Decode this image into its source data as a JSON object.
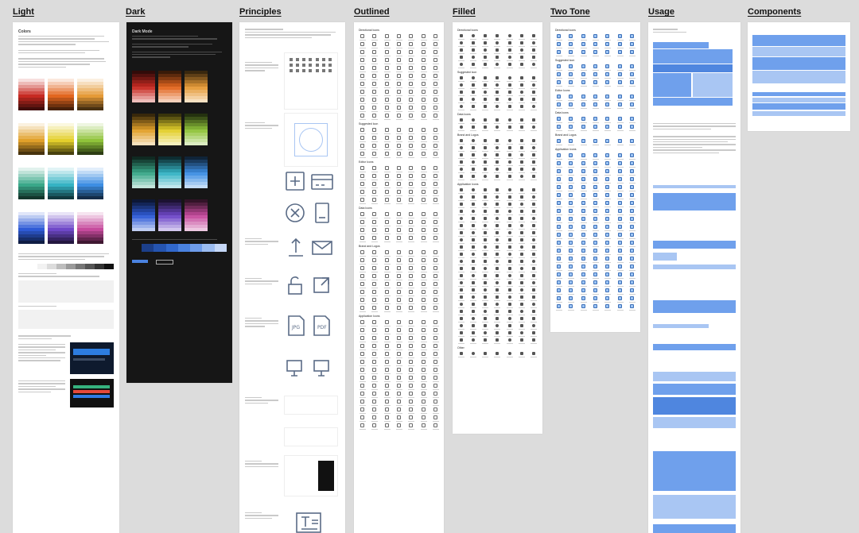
{
  "columns": [
    {
      "id": "light",
      "title": "Light"
    },
    {
      "id": "dark",
      "title": "Dark"
    },
    {
      "id": "principles",
      "title": "Principles"
    },
    {
      "id": "outlined",
      "title": "Outlined"
    },
    {
      "id": "filled",
      "title": "Filled"
    },
    {
      "id": "two_tone",
      "title": "Two Tone"
    },
    {
      "id": "usage",
      "title": "Usage"
    },
    {
      "id": "components",
      "title": "Components"
    }
  ],
  "light": {
    "heading": "Colors",
    "palette_rows": [
      {
        "colors": [
          "#c72a22",
          "#e2661f",
          "#e59a37"
        ]
      },
      {
        "colors": [
          "#e1a02a",
          "#e3cf2b",
          "#8fc33a"
        ]
      },
      {
        "colors": [
          "#3aa889",
          "#35b3c4",
          "#3d8ee3"
        ]
      },
      {
        "colors": [
          "#2f5bd6",
          "#6f48c8",
          "#c64b9d"
        ]
      }
    ],
    "gray_strip": [
      "#ffffff",
      "#f2f2f2",
      "#dcdcdc",
      "#bdbdbd",
      "#9a9a9a",
      "#767676",
      "#555555",
      "#333333",
      "#111111"
    ]
  },
  "dark": {
    "heading": "Dark Mode",
    "palette_rows": [
      {
        "colors": [
          "#c72a22",
          "#e2661f",
          "#e59a37"
        ]
      },
      {
        "colors": [
          "#e1a02a",
          "#e3cf2b",
          "#8fc33a"
        ]
      },
      {
        "colors": [
          "#3aa889",
          "#35b3c4",
          "#3d8ee3"
        ]
      },
      {
        "colors": [
          "#2f5bd6",
          "#6f48c8",
          "#c64b9d"
        ]
      }
    ]
  },
  "outlined": {
    "sections": [
      "Directional Icons",
      "Suggested Icon",
      "Editor Icons",
      "Data Icons",
      "Brand and Logos",
      "Application Icons"
    ]
  },
  "filled": {
    "sections": [
      "Directional Icons",
      "Suggested Icon",
      "Data Icons",
      "Brand and Logos",
      "Application Icons",
      "Other"
    ]
  },
  "two_tone": {
    "sections": [
      "Directional Icons",
      "Suggested Icon",
      "Editor Icons",
      "Data Icons",
      "Brand and Logos",
      "Application Icons"
    ]
  },
  "colors": {
    "canvas": "#dcdcdc",
    "page": "#ffffff",
    "dark_page": "#161616",
    "accent_blue": "#6fa0ec"
  }
}
